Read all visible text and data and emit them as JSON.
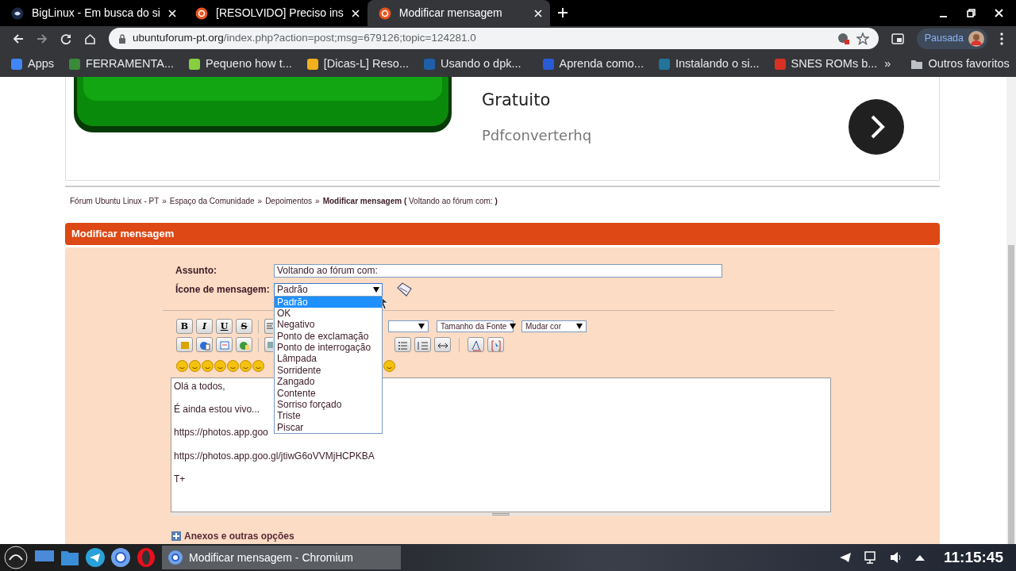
{
  "browser": {
    "tabs": [
      {
        "title": "BigLinux - Em busca do si",
        "selected": false
      },
      {
        "title": "[RESOLVIDO] Preciso ins",
        "selected": false
      },
      {
        "title": "Modificar mensagem",
        "selected": true
      }
    ],
    "address": {
      "domain": "ubuntuforum-pt.org",
      "path": "/index.php?action=post;msg=679126;topic=124281.0"
    },
    "profile": "Pausada",
    "bookmarks": [
      {
        "label": "Apps",
        "color": "#4285f4"
      },
      {
        "label": "FERRAMENTA...",
        "color": "#3a8a3a"
      },
      {
        "label": "Pequeno how t...",
        "color": "#87cf3e"
      },
      {
        "label": "[Dicas-L] Reso...",
        "color": "#f2b01e"
      },
      {
        "label": "Usando o dpk...",
        "color": "#1f5fa8"
      },
      {
        "label": "Aprenda como...",
        "color": "#2a5bd7"
      },
      {
        "label": "Instalando o si...",
        "color": "#21759b"
      },
      {
        "label": "SNES ROMs b...",
        "color": "#d93025"
      }
    ],
    "more": "»",
    "other_bookmarks": "Outros favoritos"
  },
  "ad": {
    "line": "Gratuito",
    "source": "Pdfconverterhq"
  },
  "breadcrumb": {
    "links": [
      "Fórum Ubuntu Linux - PT",
      "Espaço da Comunidade",
      "Depoimentos"
    ],
    "separator": "»",
    "current": "**Modificar mensagem (** Voltando ao fórum com: **)**"
  },
  "panel": {
    "title": "Modificar mensagem",
    "subject_label": "Assunto:",
    "subject": "Voltando ao fórum com:",
    "icon_label": "Ícone de mensagem:",
    "icon_select": {
      "value": "Padrão",
      "expanded": true,
      "options": [
        {
          "label": "Padrão",
          "selected": true
        },
        {
          "label": "OK",
          "selected": false
        },
        {
          "label": "Negativo",
          "selected": false
        },
        {
          "label": "Ponto de exclamação",
          "selected": false
        },
        {
          "label": "Ponto de interrogação",
          "selected": false
        },
        {
          "label": "Lâmpada",
          "selected": false
        },
        {
          "label": "Sorridente",
          "selected": false
        },
        {
          "label": "Zangado",
          "selected": false
        },
        {
          "label": "Contente",
          "selected": false
        },
        {
          "label": "Sorriso forçado",
          "selected": false
        },
        {
          "label": "Triste",
          "selected": false
        },
        {
          "label": "Piscar",
          "selected": false
        }
      ]
    },
    "format_buttons": [
      "B",
      "I",
      "U",
      "S"
    ],
    "font_size": "Tamanho da Fonte",
    "font_color": "Mudar cor",
    "message_lines": [
      "Olá a todos,",
      "É ainda estou vivo...",
      "https://photos.app.goo",
      "https://photos.app.goo.gl/jtiwG6oVVMjHCPKBA",
      "T+"
    ],
    "attachments": "Anexos e outras opções"
  },
  "taskbar": {
    "window": "Modificar mensagem - Chromium",
    "clock": "11:15:45"
  }
}
